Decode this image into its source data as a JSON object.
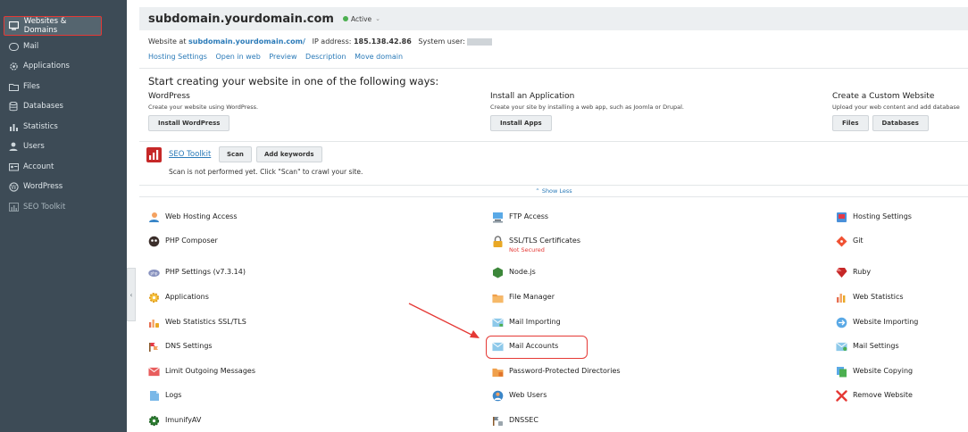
{
  "sidebar": {
    "items": [
      {
        "label": "Websites & Domains",
        "icon": "monitor-icon"
      },
      {
        "label": "Mail",
        "icon": "envelope-icon"
      },
      {
        "label": "Applications",
        "icon": "gear-icon"
      },
      {
        "label": "Files",
        "icon": "folder-icon"
      },
      {
        "label": "Databases",
        "icon": "database-icon"
      },
      {
        "label": "Statistics",
        "icon": "bar-chart-icon"
      },
      {
        "label": "Users",
        "icon": "user-icon"
      },
      {
        "label": "Account",
        "icon": "id-card-icon"
      },
      {
        "label": "WordPress",
        "icon": "wordpress-icon"
      },
      {
        "label": "SEO Toolkit",
        "icon": "seo-chart-icon"
      }
    ]
  },
  "header": {
    "domain": "subdomain.yourdomain.com",
    "status": "Active"
  },
  "info": {
    "website_at_label": "Website at",
    "website_url": "subdomain.yourdomain.com/",
    "ip_label": "IP address:",
    "ip_value": "185.138.42.86",
    "system_user_label": "System user:"
  },
  "links": [
    "Hosting Settings",
    "Open in web",
    "Preview",
    "Description",
    "Move domain"
  ],
  "create": {
    "heading": "Start creating your website in one of the following ways:",
    "wordpress": {
      "title": "WordPress",
      "desc": "Create your website using WordPress.",
      "button": "Install WordPress"
    },
    "app": {
      "title": "Install an Application",
      "desc": "Create your site by installing a web app, such as Joomla or Drupal.",
      "button": "Install Apps"
    },
    "custom": {
      "title": "Create a Custom Website",
      "desc": "Upload your web content and add database",
      "files_button": "Files",
      "databases_button": "Databases"
    }
  },
  "seo": {
    "link": "SEO Toolkit",
    "scan_button": "Scan",
    "add_keywords_button": "Add keywords",
    "message": "Scan is not performed yet. Click \"Scan\" to crawl your site."
  },
  "show_less": "Show Less",
  "tools": {
    "col1": [
      {
        "label": "Web Hosting Access",
        "icon": "user-globe-icon"
      },
      {
        "label": "PHP Composer",
        "icon": "composer-icon"
      },
      {
        "label": "PHP Settings (v7.3.14)",
        "icon": "php-icon"
      },
      {
        "label": "Applications",
        "icon": "gear-icon"
      },
      {
        "label": "Web Statistics SSL/TLS",
        "icon": "stats-lock-icon"
      },
      {
        "label": "DNS Settings",
        "icon": "dns-icon"
      },
      {
        "label": "Limit Outgoing Messages",
        "icon": "envelope-limit-icon"
      },
      {
        "label": "Logs",
        "icon": "log-file-icon"
      },
      {
        "label": "ImunifyAV",
        "icon": "shield-gear-icon"
      }
    ],
    "col2": [
      {
        "label": "FTP Access",
        "icon": "ftp-icon"
      },
      {
        "label": "SSL/TLS Certificates",
        "sub": "Not Secured",
        "icon": "lock-icon"
      },
      {
        "label": "Node.js",
        "icon": "nodejs-icon"
      },
      {
        "label": "File Manager",
        "icon": "folder-icon"
      },
      {
        "label": "Mail Importing",
        "icon": "mail-import-icon"
      },
      {
        "label": "Mail Accounts",
        "icon": "envelope-icon"
      },
      {
        "label": "Password-Protected Directories",
        "icon": "protected-folder-icon"
      },
      {
        "label": "Web Users",
        "icon": "web-users-icon"
      },
      {
        "label": "DNSSEC",
        "icon": "dnssec-icon"
      }
    ],
    "col3": [
      {
        "label": "Hosting Settings",
        "icon": "hosting-settings-icon"
      },
      {
        "label": "Git",
        "icon": "git-icon"
      },
      {
        "label": "Ruby",
        "icon": "ruby-icon"
      },
      {
        "label": "Web Statistics",
        "icon": "bar-chart-icon"
      },
      {
        "label": "Website Importing",
        "icon": "website-import-icon"
      },
      {
        "label": "Mail Settings",
        "icon": "mail-settings-icon"
      },
      {
        "label": "Website Copying",
        "icon": "copy-icon"
      },
      {
        "label": "Remove Website",
        "icon": "remove-icon"
      }
    ]
  },
  "colors": {
    "sidebar_bg": "#3d4b56",
    "link": "#2a7ab8",
    "highlight": "#e53935",
    "active_dot": "#4caf50"
  }
}
